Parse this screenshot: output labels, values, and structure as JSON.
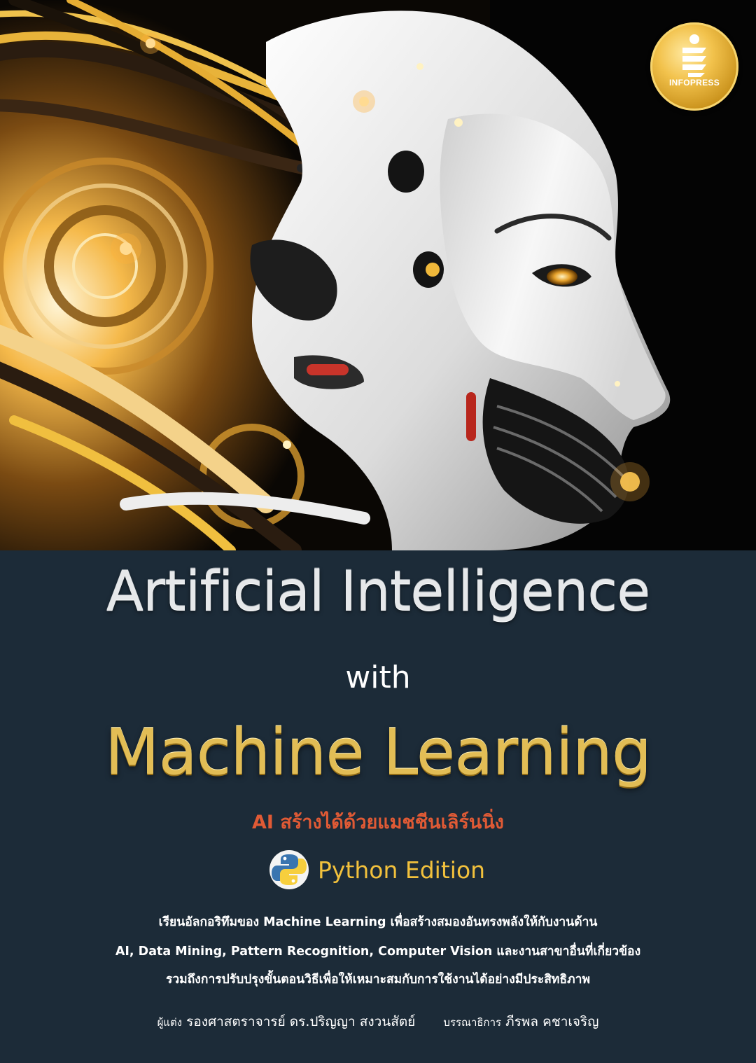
{
  "publisher": {
    "name": "INFOPRESS",
    "logo_icon": "infopress-logo-icon"
  },
  "cover_art": {
    "icon": "robot-head-illustration"
  },
  "title": {
    "line1": "Artificial Intelligence",
    "line2": "with",
    "line3": "Machine Learning"
  },
  "subtitle": "AI สร้างได้ด้วยแมชชีนเลิร์นนิ่ง",
  "edition": {
    "label": "Python Edition",
    "icon": "python-logo-icon"
  },
  "description": [
    "เรียนอัลกอริทึมของ Machine Learning เพื่อสร้างสมองอันทรงพลังให้กับงานด้าน",
    "AI, Data Mining, Pattern Recognition, Computer Vision และงานสาขาอื่นที่เกี่ยวข้อง",
    "รวมถึงการปรับปรุงขั้นตอนวิธีเพื่อให้เหมาะสมกับการใช้งานได้อย่างมีประสิทธิภาพ"
  ],
  "credits": {
    "author_role": "ผู้แต่ง",
    "author_name": "รองศาสตราจารย์ ดร.ปริญญา สงวนสัตย์",
    "editor_role": "บรรณาธิการ",
    "editor_name": "ภีรพล คชาเจริญ"
  },
  "colors": {
    "panel_background": "#1c2b38",
    "title_silver": "#e6e8ea",
    "title_gold": "#e2bd55",
    "subtitle_orange": "#e05a35",
    "edition_gold": "#f2c13c",
    "badge_gold": "#f2c24c"
  }
}
